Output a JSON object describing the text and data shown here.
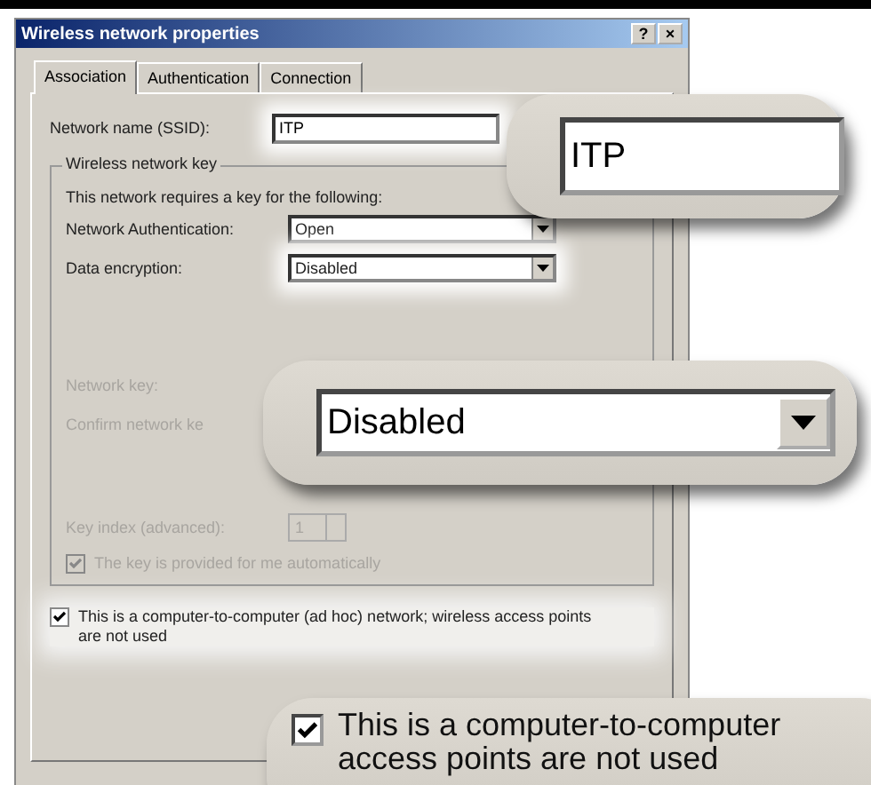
{
  "window": {
    "title": "Wireless network properties",
    "buttons": [
      "?",
      "×"
    ]
  },
  "tabs": [
    {
      "label": "Association",
      "selected": true
    },
    {
      "label": "Authentication",
      "selected": false
    },
    {
      "label": "Connection",
      "selected": false
    }
  ],
  "ssid": {
    "label": "Network name (SSID):",
    "value": "ITP"
  },
  "key_group": {
    "title": "Wireless network key",
    "intro": "This network requires a key for the following:",
    "authentication": {
      "label": "Network Authentication:",
      "value": "Open"
    },
    "encryption": {
      "label": "Data encryption:",
      "value": "Disabled"
    },
    "network_key": {
      "label": "Network key:",
      "disabled": true
    },
    "confirm_key": {
      "label": "Confirm network ke",
      "disabled": true
    },
    "key_index": {
      "label": "Key index (advanced):",
      "value": "1",
      "disabled": true
    },
    "auto_key": {
      "label": "The key is provided for me automatically",
      "checked": true,
      "disabled": true
    }
  },
  "adhoc": {
    "label": "This is a computer-to-computer (ad hoc) network; wireless access points are not used",
    "checked": true
  },
  "callouts": [
    {
      "kind": "field",
      "value": "ITP"
    },
    {
      "kind": "dropdown",
      "value": "Disabled"
    },
    {
      "kind": "checkbox",
      "checked": true,
      "lines": [
        "This is a computer-to-computer",
        "access points are not used"
      ]
    }
  ]
}
